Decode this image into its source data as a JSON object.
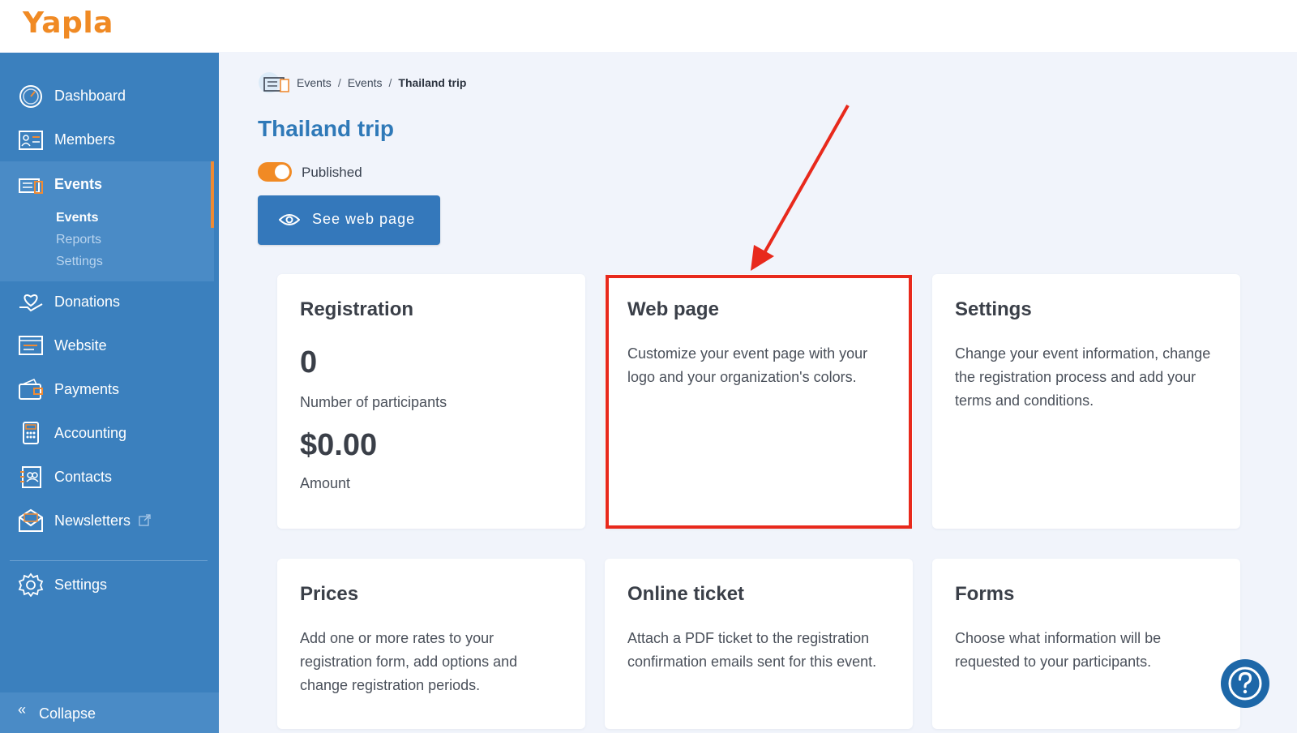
{
  "app": {
    "logo": "Yapla"
  },
  "colors": {
    "brand_orange": "#f08a24",
    "sidebar_blue": "#3b80be",
    "title_blue": "#2f79b8",
    "highlight_red": "#e8291c"
  },
  "sidebar": {
    "items": [
      {
        "label": "Dashboard",
        "icon": "dashboard-icon"
      },
      {
        "label": "Members",
        "icon": "members-icon"
      },
      {
        "label": "Events",
        "icon": "events-icon"
      },
      {
        "label": "Donations",
        "icon": "donations-icon"
      },
      {
        "label": "Website",
        "icon": "website-icon"
      },
      {
        "label": "Payments",
        "icon": "payments-icon"
      },
      {
        "label": "Accounting",
        "icon": "accounting-icon"
      },
      {
        "label": "Contacts",
        "icon": "contacts-icon"
      },
      {
        "label": "Newsletters",
        "icon": "newsletters-icon"
      },
      {
        "label": "Settings",
        "icon": "settings-gear-icon"
      }
    ],
    "events_sub": [
      "Events",
      "Reports",
      "Settings"
    ],
    "collapse_label": "Collapse",
    "collapse_icon": "«"
  },
  "breadcrumb": {
    "items": [
      "Events",
      "Events"
    ],
    "current": "Thailand trip",
    "separator": "/"
  },
  "page": {
    "title": "Thailand trip",
    "status": "Published",
    "see_web_page": "See web page"
  },
  "cards": {
    "registration": {
      "title": "Registration",
      "count": "0",
      "count_label": "Number of participants",
      "amount": "$0.00",
      "amount_label": "Amount"
    },
    "web_page": {
      "title": "Web page",
      "desc": "Customize your event page with your logo and your organization's colors."
    },
    "settings": {
      "title": "Settings",
      "desc": "Change your event information, change the registration process and add your terms and conditions."
    },
    "prices": {
      "title": "Prices",
      "desc": "Add one or more rates to your registration form, add options and change registration periods."
    },
    "online_ticket": {
      "title": "Online ticket",
      "desc": "Attach a PDF ticket to the registration confirmation emails sent for this event."
    },
    "forms": {
      "title": "Forms",
      "desc": "Choose what information will be requested to your participants."
    }
  }
}
